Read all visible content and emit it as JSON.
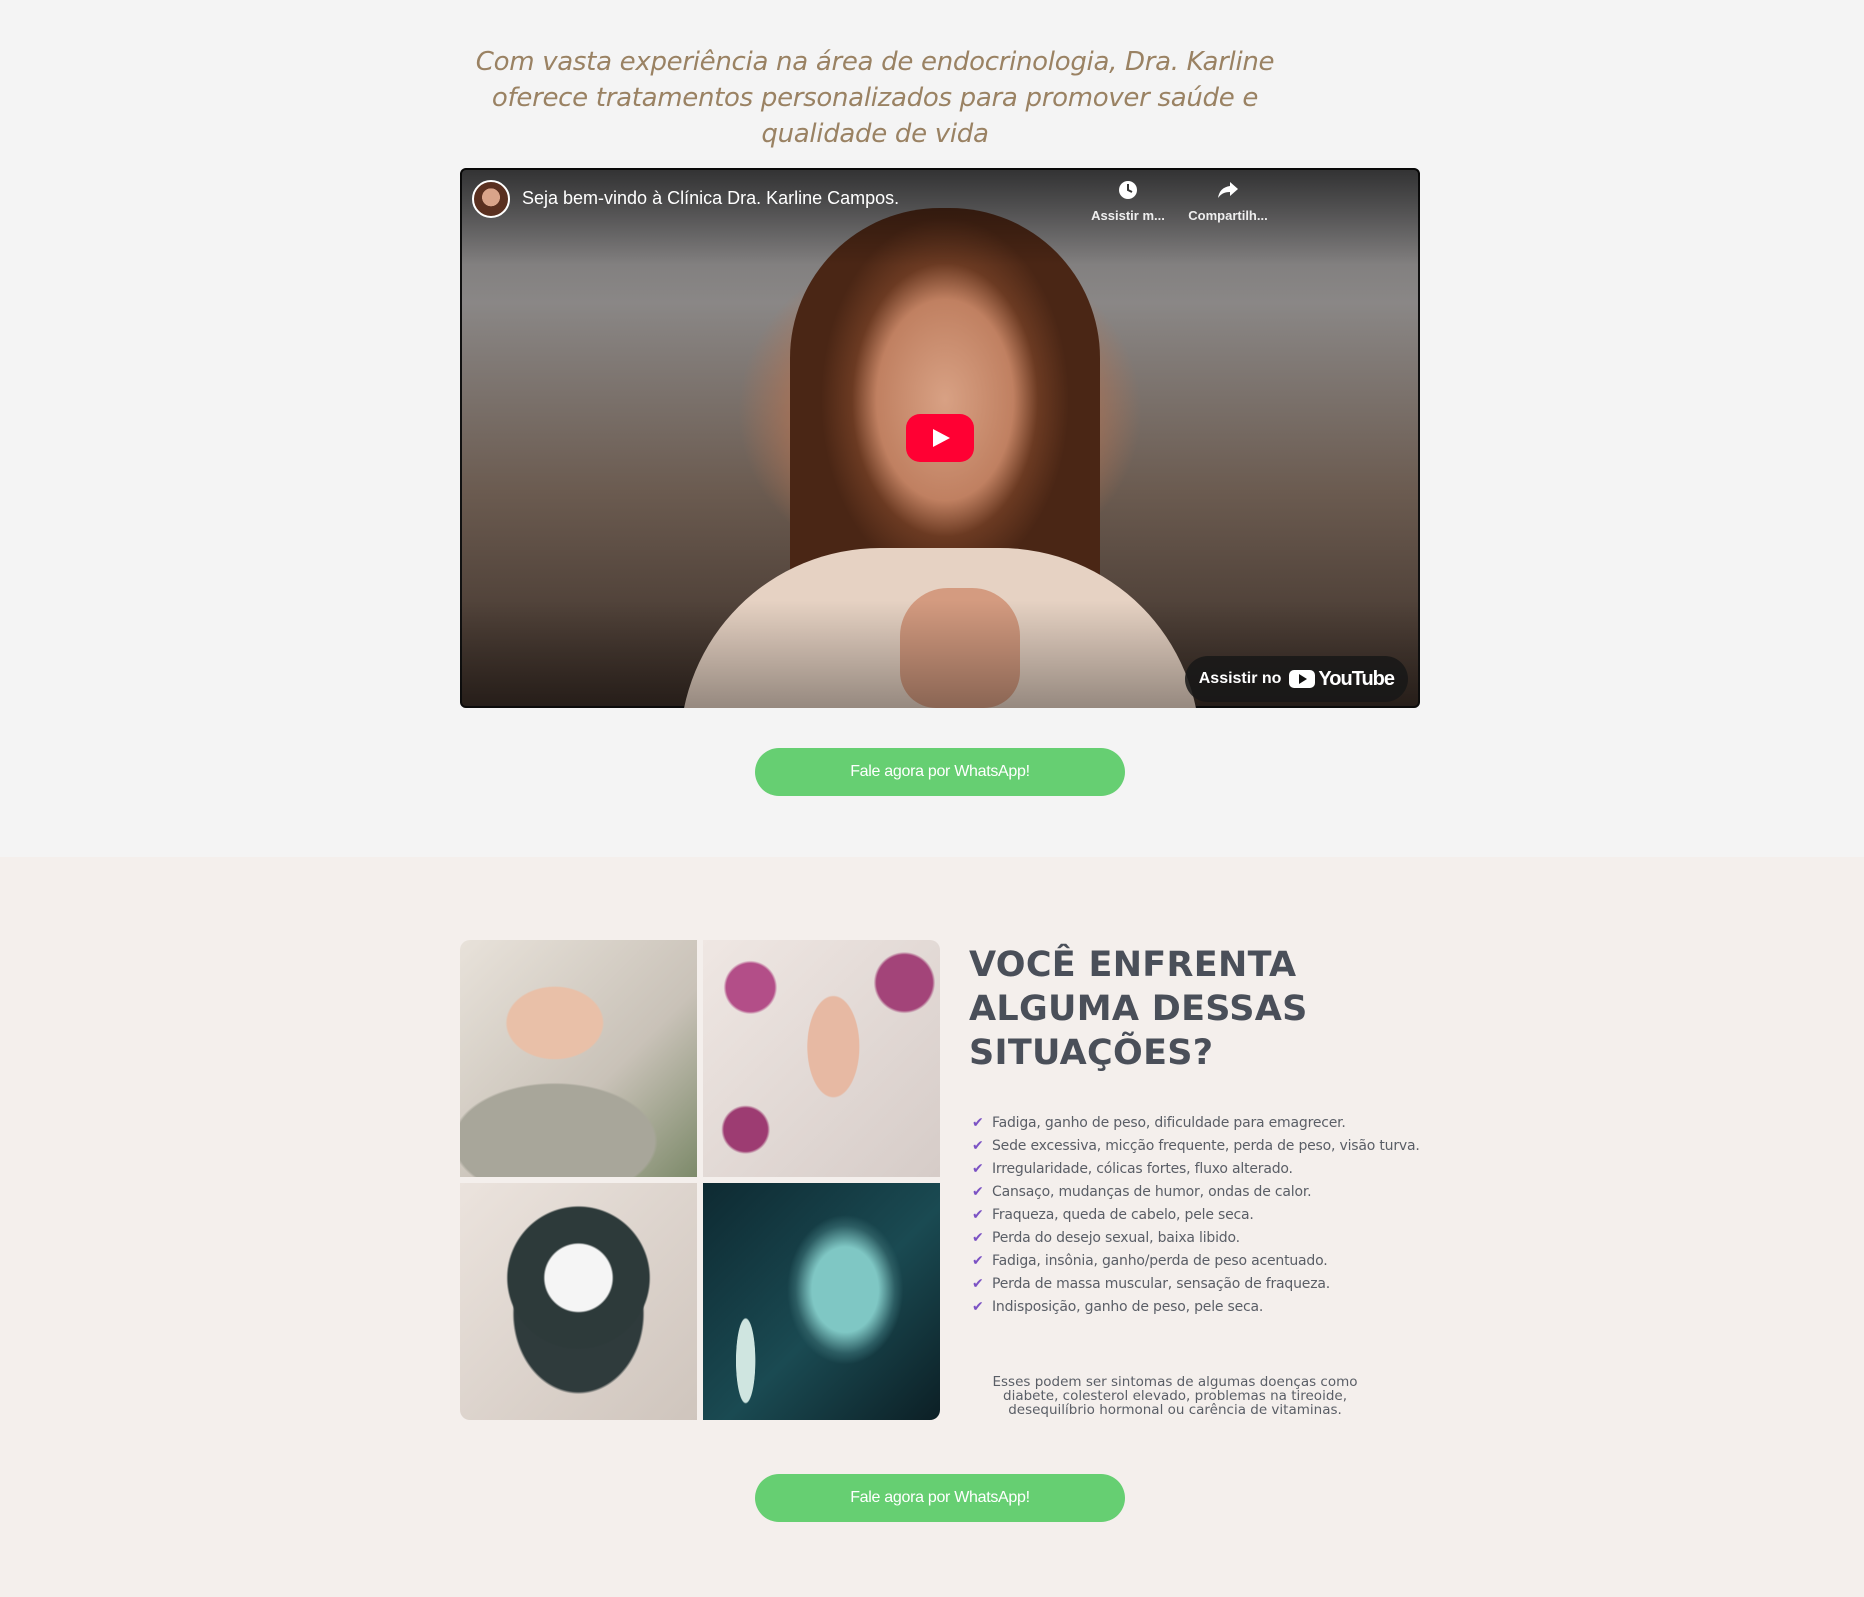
{
  "intro": {
    "text": "Com vasta experiência na área de endocrinologia, Dra. Karline oferece tratamentos personalizados para promover saúde e qualidade de vida"
  },
  "video": {
    "title": "Seja bem-vindo à Clínica Dra. Karline Campos.",
    "watch_later": "Assistir m...",
    "share": "Compartilh...",
    "watch_on": "Assistir no",
    "youtube": "YouTube"
  },
  "cta_top": {
    "label": "Fale agora por WhatsApp!"
  },
  "situations": {
    "heading": "VOCÊ ENFRENTA ALGUMA DESSAS SITUAÇÕES?",
    "items": [
      "Fadiga, ganho de peso, dificuldade para emagrecer.",
      "Sede excessiva, micção frequente, perda de peso, visão turva.",
      "Irregularidade, cólicas fortes, fluxo alterado.",
      "Cansaço, mudanças de humor, ondas de calor.",
      "Fraqueza, queda de cabelo, pele seca.",
      "Perda do desejo sexual, baixa libido.",
      "Fadiga, insônia, ganho/perda de peso acentuado.",
      "Perda de massa muscular, sensação de fraqueza.",
      "Indisposição, ganho de peso, pele seca."
    ],
    "note": "Esses podem ser sintomas de algumas doenças como diabete, colesterol elevado, problemas na tireoide, desequilíbrio hormonal ou carência de vitaminas."
  },
  "cta_bottom": {
    "label": "Fale agora por WhatsApp!"
  },
  "colors": {
    "cta_green": "#66cf72",
    "youtube_red": "#ff0033",
    "check_purple": "#7b52c4",
    "intro_gold": "#9a8263"
  }
}
